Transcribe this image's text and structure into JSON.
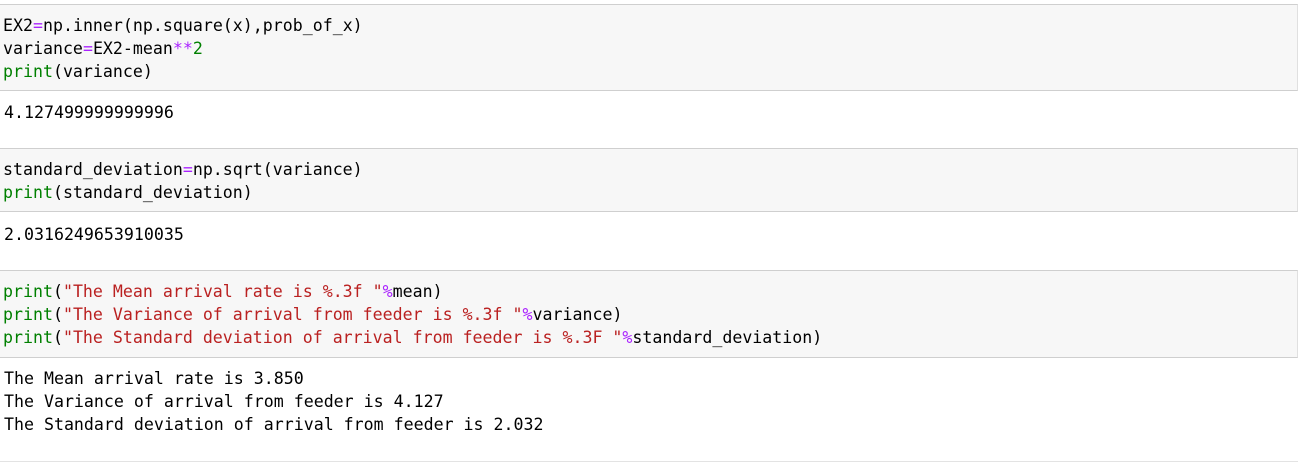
{
  "cells": [
    {
      "input": {
        "lines": [
          [
            "EX2",
            "=",
            "np.inner(np.square(x),prob_of_x)"
          ],
          [
            "variance",
            "=",
            "EX2-mean",
            "**",
            "2"
          ],
          [
            "print",
            "(variance)"
          ]
        ]
      },
      "output": [
        "4.127499999999996"
      ]
    },
    {
      "input": {
        "lines": [
          [
            "standard_deviation",
            "=",
            "np.sqrt(variance)"
          ],
          [
            "print",
            "(standard_deviation)"
          ]
        ]
      },
      "output": [
        "2.0316249653910035"
      ]
    },
    {
      "input": {
        "lines": [
          [
            "print",
            "(",
            "\"The Mean arrival rate is %.3f \"",
            "%",
            "mean)"
          ],
          [
            "print",
            "(",
            "\"The Variance of arrival from feeder is %.3f \"",
            "%",
            "variance)"
          ],
          [
            "print",
            "(",
            "\"The Standard deviation of arrival from feeder is %.3F \"",
            "%",
            "standard_deviation)"
          ]
        ]
      },
      "output": [
        "The Mean arrival rate is 3.850",
        "The Variance of arrival from feeder is 4.127",
        "The Standard deviation of arrival from feeder is 2.032"
      ]
    }
  ],
  "colors": {
    "input_bg": "#f7f7f7",
    "keyword": "#008000",
    "operator": "#aa22ff",
    "string": "#ba2121",
    "number": "#008000"
  }
}
